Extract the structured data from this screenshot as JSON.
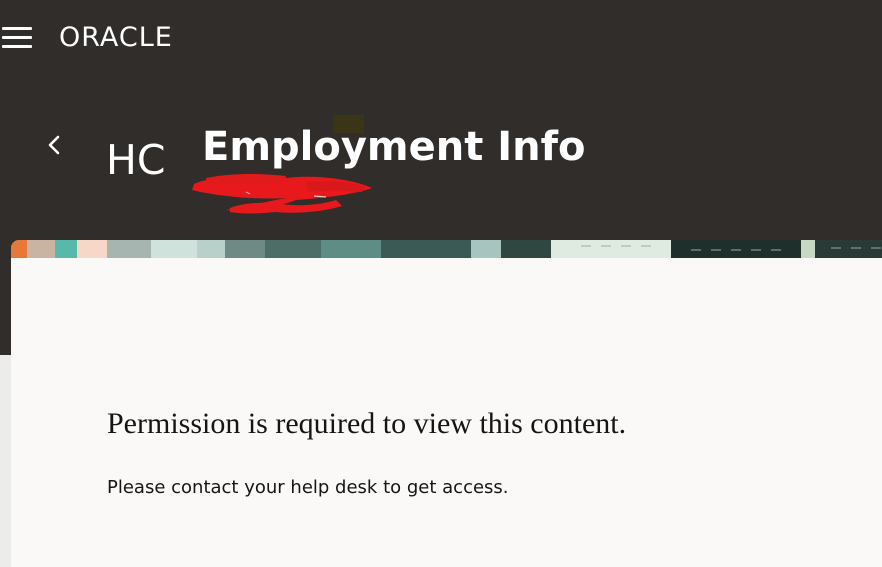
{
  "header": {
    "logo_text": "ORACLE",
    "avatar_initials": "HC",
    "title": "Employment Info",
    "background_color": "#312d2a"
  },
  "icons": {
    "menu": "hamburger-menu-icon",
    "back": "chevron-left-icon"
  },
  "message": {
    "heading": "Permission is required to view this content.",
    "body": "Please contact your help desk to get access."
  },
  "colors": {
    "card_background": "#faf9f8",
    "text": "#161513",
    "redaction": "#e8191c"
  }
}
